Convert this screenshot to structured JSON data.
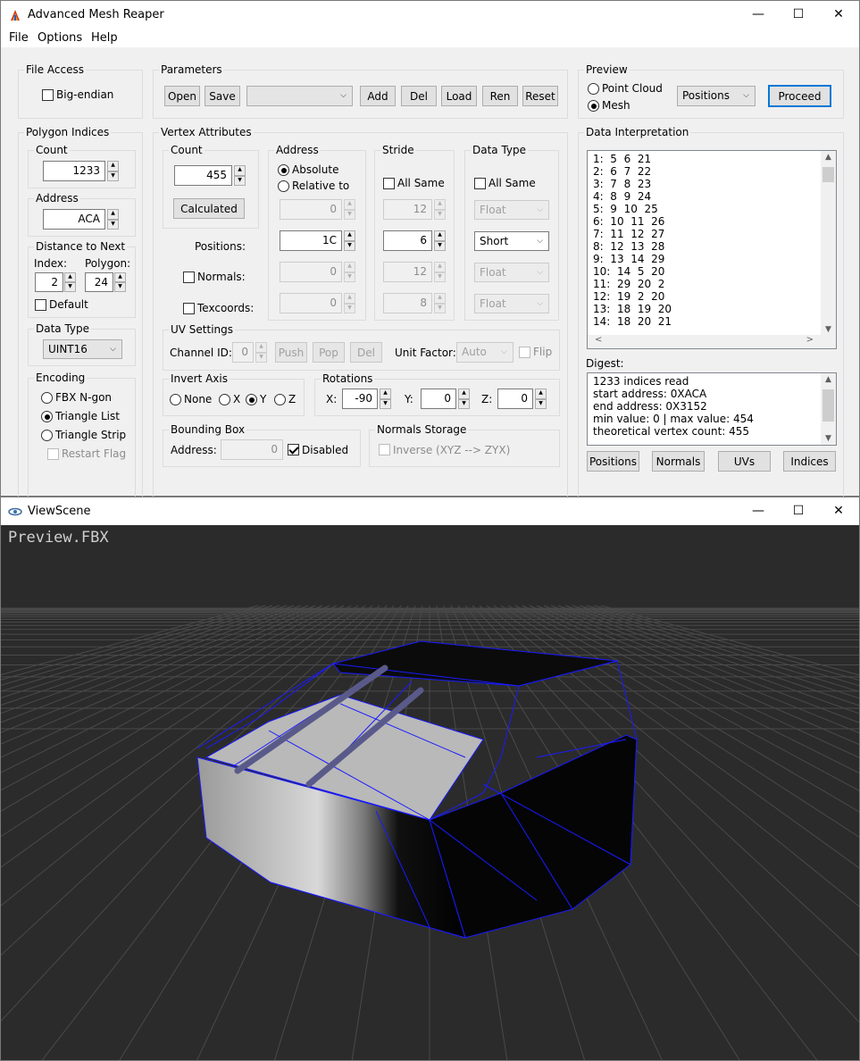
{
  "main_window": {
    "title": "Advanced Mesh Reaper",
    "controls": {
      "minimize": "—",
      "maximize": "☐",
      "close": "✕"
    },
    "menu": [
      "File",
      "Options",
      "Help"
    ]
  },
  "file_access": {
    "label": "File Access",
    "big_endian": "Big-endian",
    "big_endian_checked": false
  },
  "parameters": {
    "label": "Parameters",
    "open": "Open",
    "save": "Save",
    "preset_value": "",
    "add": "Add",
    "del": "Del",
    "load": "Load",
    "ren": "Ren",
    "reset": "Reset"
  },
  "preview": {
    "label": "Preview",
    "point_cloud": "Point Cloud",
    "mesh": "Mesh",
    "selected": "mesh",
    "mode_value": "Positions",
    "proceed": "Proceed"
  },
  "polygon_indices": {
    "label": "Polygon Indices",
    "count_label": "Count",
    "count_value": "1233",
    "address_label": "Address",
    "address_value": "ACA",
    "distance_label": "Distance to Next",
    "index_label": "Index:",
    "index_value": "2",
    "polygon_label": "Polygon:",
    "polygon_value": "24",
    "default_label": "Default",
    "default_checked": false,
    "data_type_label": "Data Type",
    "data_type_value": "UINT16",
    "encoding_label": "Encoding",
    "fbx_ngon": "FBX N-gon",
    "triangle_list": "Triangle List",
    "triangle_strip": "Triangle Strip",
    "encoding_selected": "triangle_list",
    "restart_flag": "Restart Flag"
  },
  "vertex_attributes": {
    "label": "Vertex Attributes",
    "count_label": "Count",
    "count_value": "455",
    "calculated": "Calculated",
    "positions_label": "Positions:",
    "normals_label": "Normals:",
    "texcoords_label": "Texcoords:",
    "address_label": "Address",
    "absolute": "Absolute",
    "relative_to": "Relative to",
    "relative_value": "0",
    "positions_address": "1C",
    "normals_address": "0",
    "texcoords_address": "0",
    "stride_label": "Stride",
    "all_same": "All Same",
    "stride_relative": "12",
    "stride_positions": "6",
    "stride_normals": "12",
    "stride_texcoords": "8",
    "data_type_label": "Data Type",
    "type_relative": "Float",
    "type_positions": "Short",
    "type_normals": "Float",
    "type_texcoords": "Float"
  },
  "uv_settings": {
    "label": "UV Settings",
    "channel_label": "Channel ID:",
    "channel_value": "0",
    "push": "Push",
    "pop": "Pop",
    "del": "Del",
    "unit_factor_label": "Unit Factor:",
    "unit_factor_value": "Auto",
    "flip": "Flip"
  },
  "invert_axis": {
    "label": "Invert Axis",
    "none": "None",
    "x": "X",
    "y": "Y",
    "z": "Z",
    "selected": "y"
  },
  "rotations": {
    "label": "Rotations",
    "x_label": "X:",
    "x_value": "-90",
    "y_label": "Y:",
    "y_value": "0",
    "z_label": "Z:",
    "z_value": "0"
  },
  "bounding_box": {
    "label": "Bounding Box",
    "address_label": "Address:",
    "address_value": "0",
    "disabled": "Disabled",
    "disabled_checked": true
  },
  "normals_storage": {
    "label": "Normals Storage",
    "inverse": "Inverse (XYZ --> ZYX)"
  },
  "data_interpretation": {
    "label": "Data Interpretation",
    "lines": [
      "1:  5  6  21",
      "2:  6  7  22",
      "3:  7  8  23",
      "4:  8  9  24",
      "5:  9  10  25",
      "6:  10  11  26",
      "7:  11  12  27",
      "8:  12  13  28",
      "9:  13  14  29",
      "10:  14  5  20",
      "11:  29  20  2",
      "12:  19  2  20",
      "13:  18  19  20",
      "14:  18  20  21"
    ]
  },
  "digest": {
    "label": "Digest:",
    "lines": [
      "1233 indices read",
      "start address: 0XACA",
      "end address: 0X3152",
      "min value: 0 | max value: 454",
      "theoretical vertex count: 455"
    ]
  },
  "bottom_buttons": {
    "positions": "Positions",
    "normals": "Normals",
    "uvs": "UVs",
    "indices": "Indices"
  },
  "view_window": {
    "title": "ViewScene",
    "controls": {
      "minimize": "—",
      "maximize": "☐",
      "close": "✕"
    },
    "viewport_label": "Preview.FBX",
    "background_color": "#2b2b2b",
    "wireframe_color": "#1a1aff"
  }
}
